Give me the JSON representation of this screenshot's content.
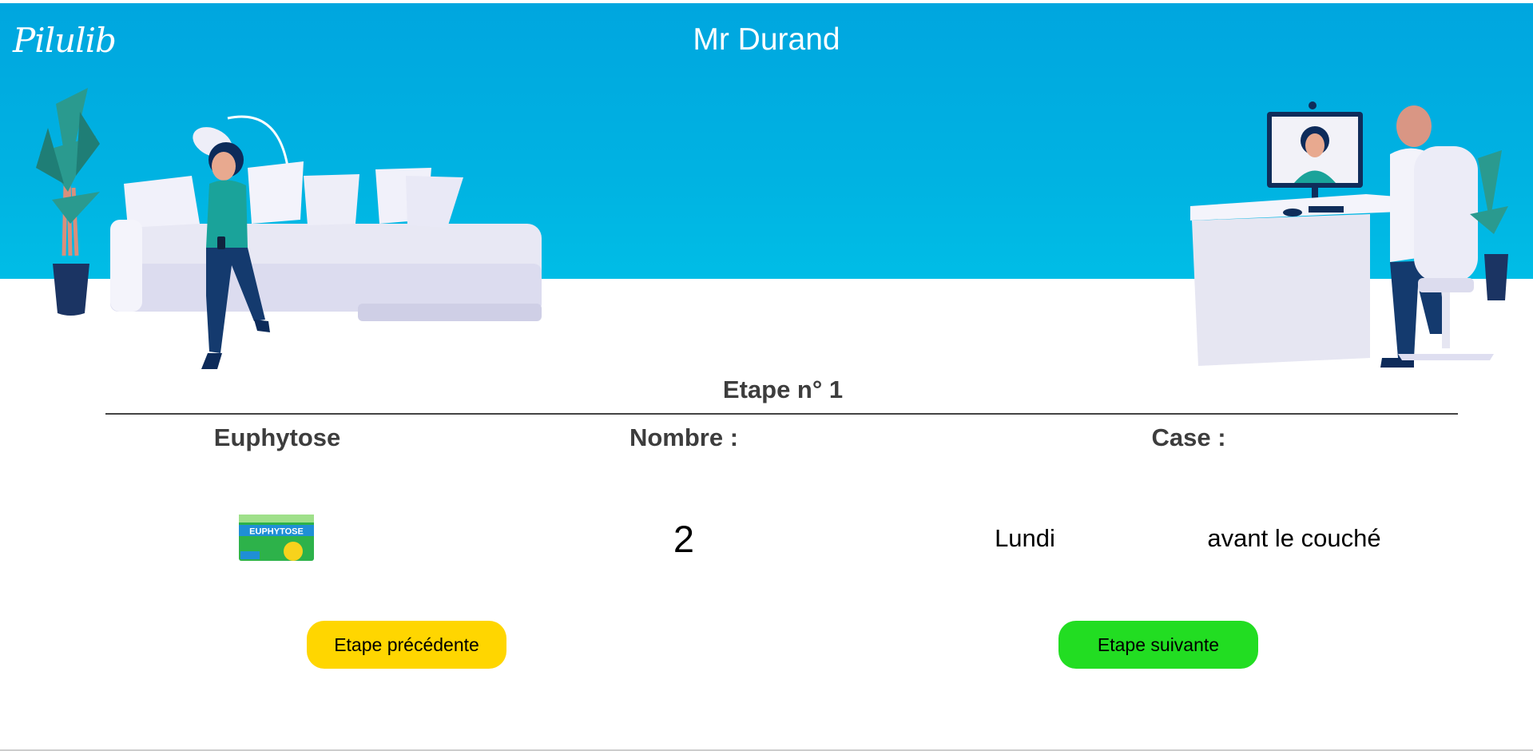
{
  "app": {
    "logo": "Pilulib"
  },
  "header": {
    "patient_name": "Mr Durand"
  },
  "step": {
    "title": "Etape n° 1",
    "headers": {
      "medicine": "Euphytose",
      "count": "Nombre :",
      "case": "Case :"
    },
    "medicine_box_text": "EUPHYTOSE",
    "count_value": "2",
    "day": "Lundi",
    "moment": "avant le couché"
  },
  "buttons": {
    "previous": "Etape précédente",
    "next": "Etape suivante"
  },
  "colors": {
    "header_blue": "#00a6df",
    "previous_button": "#ffd600",
    "next_button": "#22dd22"
  }
}
